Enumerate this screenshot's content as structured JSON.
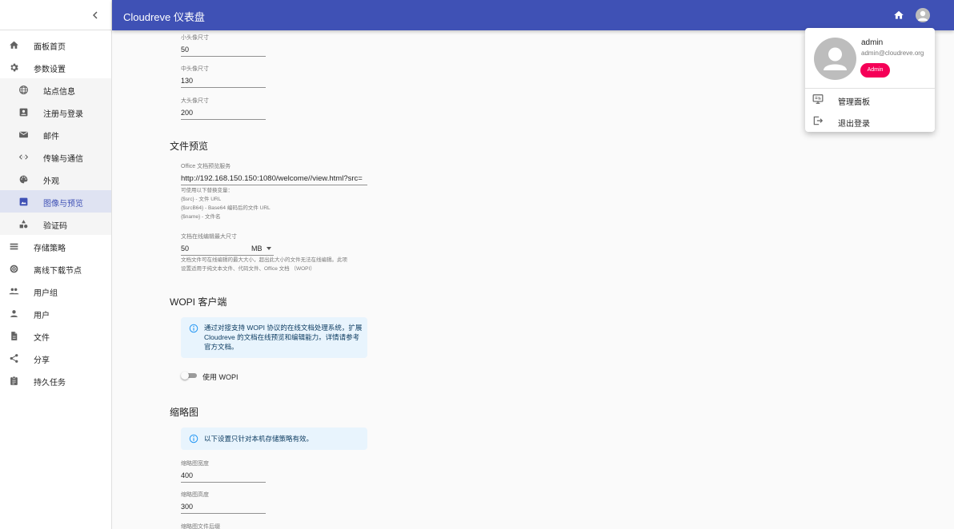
{
  "appbar": {
    "title": "Cloudreve 仪表盘"
  },
  "sidebar": {
    "items": [
      {
        "label": "面板首页",
        "icon": "home-icon"
      },
      {
        "label": "参数设置",
        "icon": "gear-icon"
      },
      {
        "label": "站点信息",
        "icon": "globe-icon",
        "sub": true
      },
      {
        "label": "注册与登录",
        "icon": "contact-card-icon",
        "sub": true
      },
      {
        "label": "邮件",
        "icon": "mail-icon",
        "sub": true
      },
      {
        "label": "传输与通信",
        "icon": "code-arrows-icon",
        "sub": true
      },
      {
        "label": "外观",
        "icon": "palette-icon",
        "sub": true
      },
      {
        "label": "图像与预览",
        "icon": "image-icon",
        "sub": true,
        "active": true
      },
      {
        "label": "验证码",
        "icon": "shapes-icon",
        "sub": true
      },
      {
        "label": "存储策略",
        "icon": "storage-icon"
      },
      {
        "label": "离线下载节点",
        "icon": "download-node-icon"
      },
      {
        "label": "用户组",
        "icon": "group-icon"
      },
      {
        "label": "用户",
        "icon": "person-icon"
      },
      {
        "label": "文件",
        "icon": "file-icon"
      },
      {
        "label": "分享",
        "icon": "share-icon"
      },
      {
        "label": "持久任务",
        "icon": "task-icon"
      }
    ]
  },
  "avatar_fields": {
    "small": {
      "label": "小头像尺寸",
      "value": "50"
    },
    "medium": {
      "label": "中头像尺寸",
      "value": "130"
    },
    "large": {
      "label": "大头像尺寸",
      "value": "200"
    }
  },
  "preview": {
    "title": "文件预览",
    "office": {
      "label": "Office 文档预览服务",
      "value": "http://192.168.150.150:1080/welcome//view.html?src="
    },
    "vars": [
      "可使用以下替换变量：",
      "{$src} - 文件 URL",
      "{$srcB64} - Base64 编码后的文件 URL",
      "{$name} - 文件名"
    ],
    "maxsize": {
      "label": "文档在线编辑最大尺寸",
      "value": "50",
      "unit": "MB"
    },
    "maxsize_help": [
      "文档文件可在线编辑的最大大小，超出此大小的文件无法在线编辑。此项",
      "设置适用于纯文本文件、代码文件、Office 文档 （WOPI）"
    ]
  },
  "wopi": {
    "title": "WOPI 客户端",
    "info": [
      "通过对接支持 WOPI 协议的在线文档处理系统，扩展",
      "Cloudreve 的文档在线预览和编辑能力。详情请参考",
      "官方文档。"
    ],
    "switch_label": "使用 WOPI",
    "enabled": false
  },
  "thumb": {
    "title": "缩略图",
    "info": "以下设置只针对本机存储策略有效。",
    "width": {
      "label": "缩略图宽度",
      "value": "400"
    },
    "height": {
      "label": "缩略图高度",
      "value": "300"
    },
    "suffix": {
      "label": "缩略图文件后缀"
    }
  },
  "menu": {
    "name": "admin",
    "email": "admin@cloudreve.org",
    "badge": "Admin",
    "items": [
      {
        "label": "管理面板",
        "icon": "dashboard-icon"
      },
      {
        "label": "退出登录",
        "icon": "logout-icon"
      }
    ]
  },
  "colors": {
    "primary": "#3f51b5",
    "badge": "#f50057",
    "info_bg": "#e8f4fd"
  }
}
